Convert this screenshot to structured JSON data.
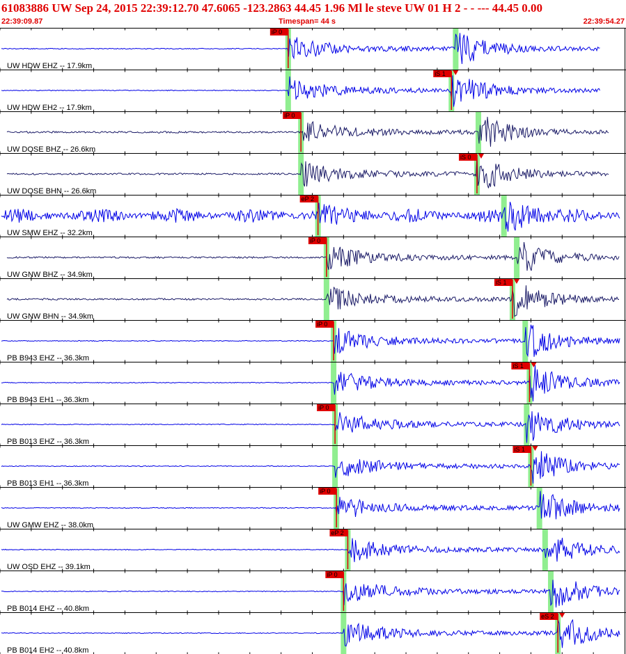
{
  "header": {
    "event_line": "61083886 UW Sep 24, 2015 22:39:12.70   47.6065 -123.2863 44.45 1.96 Ml le     steve     UW 01 H    2  -  - --- 44.45 0.00",
    "start_time": "22:39:09.87",
    "timespan": "Timespan=  44 s",
    "end_time": "22:39:54.27"
  },
  "colors": {
    "header": "#e00000",
    "trace_short": "#0000e6",
    "trace_broad": "#1a1a66",
    "pick_marker": "#e00000",
    "pick_window": "#90ee90"
  },
  "chart_data": {
    "type": "line",
    "title": "",
    "x_start": "22:39:09.87",
    "x_end": "22:39:54.27",
    "timespan_s": 44,
    "traces": [
      {
        "label": "UW HDW EHZ -- 17.9km",
        "color": "blue",
        "p_s": 20.3,
        "s_s": 32.1,
        "pick": {
          "text": "iP 0",
          "type": "P",
          "t": 20.3
        }
      },
      {
        "label": "UW HDW EH2 -- 17.9km",
        "color": "blue",
        "p_s": 20.3,
        "s_s": 31.8,
        "pick": {
          "text": "iS 1",
          "type": "S",
          "t": 31.8
        }
      },
      {
        "label": "UW DOSE BHZ -- 26.6km",
        "color": "dark",
        "p_s": 21.2,
        "s_s": 33.7,
        "pick": {
          "text": "iP 0",
          "type": "P",
          "t": 21.2
        }
      },
      {
        "label": "UW DOSE BHN -- 26.6km",
        "color": "dark",
        "p_s": 21.2,
        "s_s": 33.6,
        "pick": {
          "text": "iS 0",
          "type": "S",
          "t": 33.6
        }
      },
      {
        "label": "UW SMW EHZ -- 32.2km",
        "color": "blue",
        "p_s": 22.4,
        "s_s": 35.5,
        "pick": {
          "text": "eP 2",
          "type": "P",
          "t": 22.4
        }
      },
      {
        "label": "UW GNW BHZ -- 34.9km",
        "color": "dark",
        "p_s": 23.0,
        "s_s": 36.4,
        "pick": {
          "text": "iP 0",
          "type": "P",
          "t": 23.0
        }
      },
      {
        "label": "UW GNW BHN -- 34.9km",
        "color": "dark",
        "p_s": 23.0,
        "s_s": 36.1,
        "pick": {
          "text": "iS 1",
          "type": "S",
          "t": 36.1
        }
      },
      {
        "label": "PB B943 EHZ -- 36.3km",
        "color": "blue",
        "p_s": 23.5,
        "s_s": 37.0,
        "pick": {
          "text": "iP 0",
          "type": "P",
          "t": 23.5
        }
      },
      {
        "label": "PB B943 EH1 -- 36.3km",
        "color": "blue",
        "p_s": 23.5,
        "s_s": 37.3,
        "pick": {
          "text": "iS 1",
          "type": "S",
          "t": 37.3
        }
      },
      {
        "label": "PB B013 EHZ -- 36.3km",
        "color": "blue",
        "p_s": 23.6,
        "s_s": 37.1,
        "pick": {
          "text": "iP 0",
          "type": "P",
          "t": 23.6
        }
      },
      {
        "label": "PB B013 EH1 -- 36.3km",
        "color": "blue",
        "p_s": 23.6,
        "s_s": 37.4,
        "pick": {
          "text": "iS 1",
          "type": "S",
          "t": 37.4
        }
      },
      {
        "label": "UW GMW EHZ -- 38.0km",
        "color": "blue",
        "p_s": 23.7,
        "s_s": 38.0,
        "pick": {
          "text": "iP 0",
          "type": "P",
          "t": 23.7
        }
      },
      {
        "label": "UW OSD EHZ -- 39.1km",
        "color": "blue",
        "p_s": 24.5,
        "s_s": 38.4,
        "pick": {
          "text": "eP 2",
          "type": "P",
          "t": 24.5
        }
      },
      {
        "label": "PB B014 EHZ -- 40.8km",
        "color": "blue",
        "p_s": 24.2,
        "s_s": 38.8,
        "pick": {
          "text": "iP 0",
          "type": "P",
          "t": 24.2
        }
      },
      {
        "label": "PB B014 EH2 -- 40.8km",
        "color": "blue",
        "p_s": 24.2,
        "s_s": 39.3,
        "pick": {
          "text": "eS 2",
          "type": "S",
          "t": 39.3
        }
      }
    ]
  }
}
